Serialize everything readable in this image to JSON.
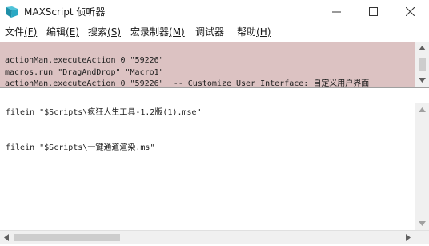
{
  "window": {
    "title": "MAXScript 侦听器",
    "icon": "3dsmax-icon"
  },
  "menu": [
    {
      "label": "文件",
      "mnemonic": "(F)"
    },
    {
      "label": "编辑",
      "mnemonic": "(E)"
    },
    {
      "label": "搜索",
      "mnemonic": "(S)"
    },
    {
      "label": "宏录制器",
      "mnemonic": "(M)"
    },
    {
      "label": "调试器",
      "mnemonic": ""
    },
    {
      "label": "帮助",
      "mnemonic": "(H)"
    }
  ],
  "listener_lines": [
    "actionMan.executeAction 0 \"59226\"",
    "macros.run \"DragAndDrop\" \"Macro1\"",
    "actionMan.executeAction 0 \"59226\"  -- Customize User Interface: 自定义用户界面"
  ],
  "editor_lines": [
    "filein \"$Scripts\\疯狂人生工具-1.2版(1).mse\"",
    "filein \"$Scripts\\一键通道渲染.ms\""
  ],
  "colors": {
    "listener_bg": "#dcc2c2",
    "editor_bg": "#ffffff"
  }
}
